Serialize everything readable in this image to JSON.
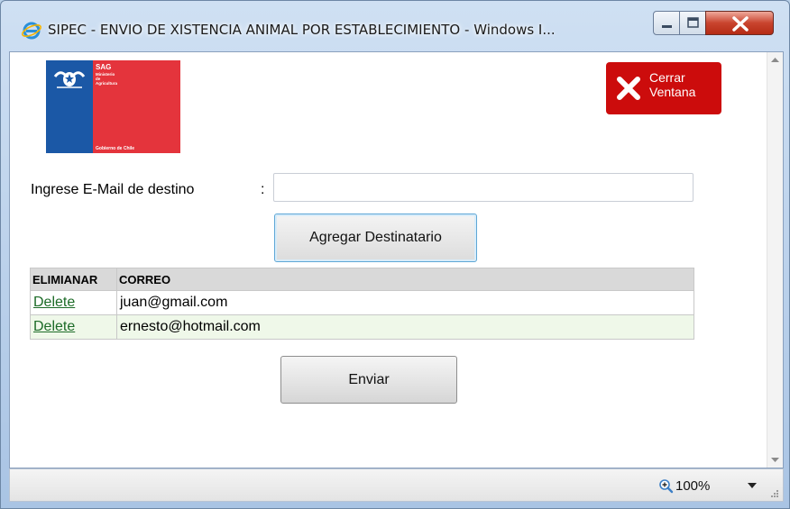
{
  "window": {
    "title": "SIPEC - ENVIO DE XISTENCIA ANIMAL POR ESTABLECIMIENTO - Windows I...",
    "icon": "ie-icon",
    "buttons": [
      "minimize-icon",
      "maximize-icon",
      "close-icon"
    ]
  },
  "logo": {
    "org": "SAG",
    "ministry": "Ministerio de Agricultura",
    "government": "Gobierno de Chile",
    "colors": {
      "blue": "#1b58a6",
      "red": "#e4343c"
    }
  },
  "close_window": {
    "label": "Cerrar Ventana",
    "color": "#cc0c0c"
  },
  "form": {
    "email_label": "Ingrese E-Mail de destino",
    "colon": ":",
    "email_value": "",
    "add_button": "Agregar Destinatario"
  },
  "table": {
    "headers": [
      "ELIMIANAR",
      "CORREO"
    ],
    "rows": [
      {
        "action": "Delete",
        "email": "juan@gmail.com"
      },
      {
        "action": "Delete",
        "email": "ernesto@hotmail.com"
      }
    ]
  },
  "send_button": "Enviar",
  "status": {
    "zoom": "100%"
  }
}
